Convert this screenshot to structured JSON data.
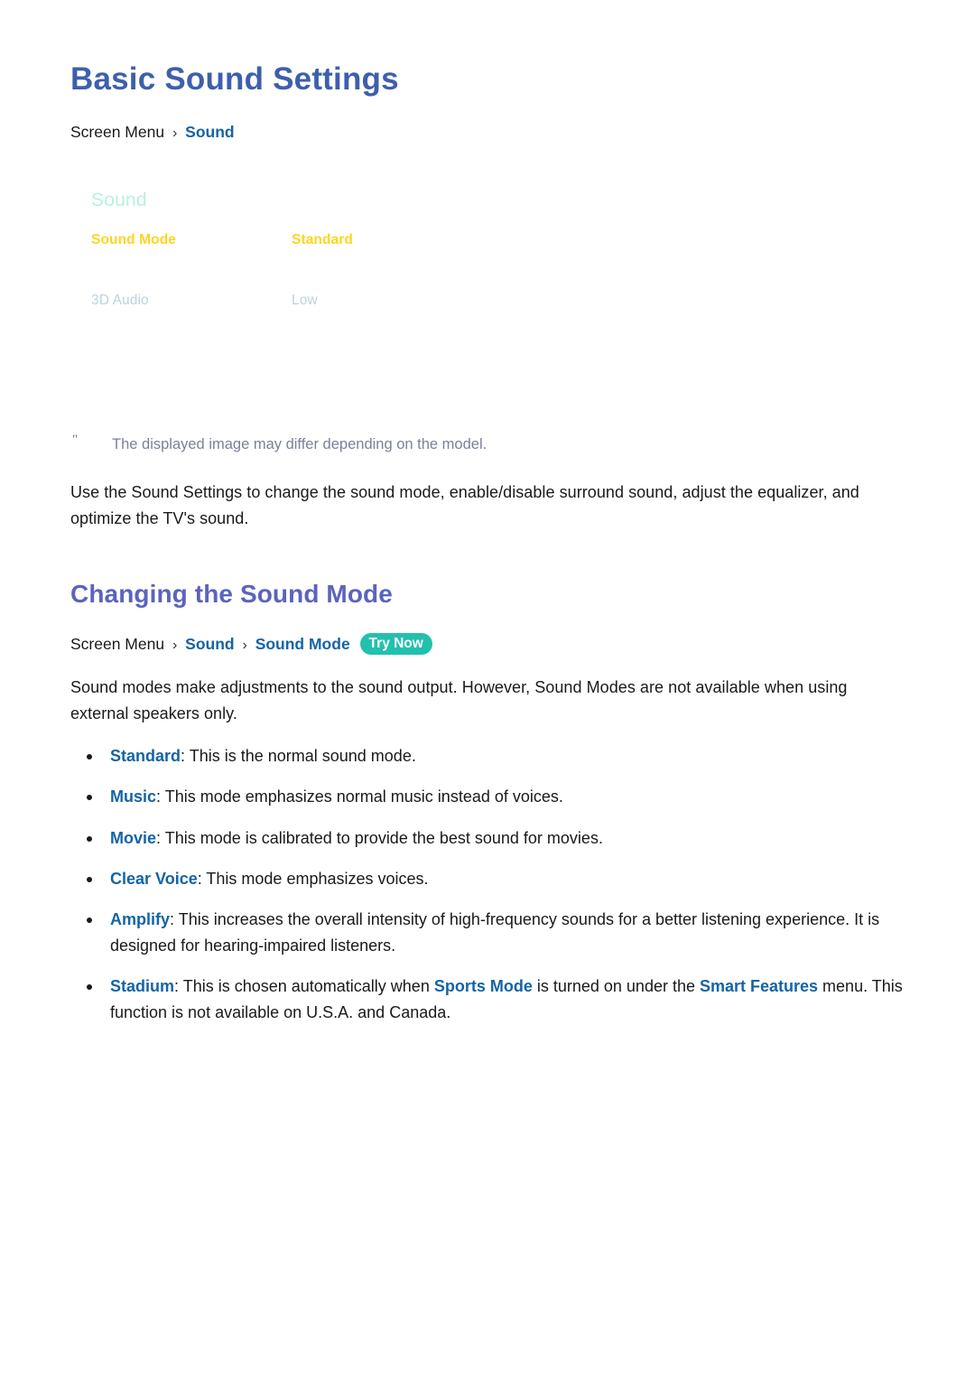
{
  "page": {
    "title": "Basic Sound Settings"
  },
  "breadcrumb_top": {
    "root": "Screen Menu",
    "separator": "›",
    "item1": "Sound"
  },
  "tv_mock": {
    "menu_title": "Sound",
    "rows": [
      {
        "label": "Sound Mode",
        "value": "Standard",
        "state": "active"
      },
      {
        "label": "3D Audio",
        "value": "Low",
        "state": "dim"
      }
    ],
    "colors": {
      "menu_title": "#b4f3dd",
      "active": "#ffd520",
      "dim": "#bcd3dd"
    }
  },
  "footnote": {
    "marker": "\"",
    "text": "The displayed image may differ depending on the model."
  },
  "intro_paragraph": "Use the Sound Settings to change the sound mode, enable/disable surround sound, adjust the equalizer, and optimize the TV's sound.",
  "section": {
    "heading": "Changing the Sound Mode",
    "breadcrumb": {
      "root": "Screen Menu",
      "separator": "›",
      "item1": "Sound",
      "item2": "Sound Mode",
      "badge": "Try Now"
    },
    "paragraph": "Sound modes make adjustments to the sound output. However, Sound Modes are not available when using external speakers only.",
    "bullets": [
      {
        "term": "Standard",
        "sep": ": ",
        "text": "This is the normal sound mode."
      },
      {
        "term": "Music",
        "sep": ": ",
        "text": "This mode emphasizes normal music instead of voices."
      },
      {
        "term": "Movie",
        "sep": ": ",
        "text": "This mode is calibrated to provide the best sound for movies."
      },
      {
        "term": "Clear Voice",
        "sep": ": ",
        "text": "This mode emphasizes voices."
      },
      {
        "term": "Amplify",
        "sep": ": ",
        "text": "This increases the overall intensity of high-frequency sounds for a better listening experience. It is designed for hearing-impaired listeners."
      },
      {
        "term": "Stadium",
        "sep": ": ",
        "text_part1": "This is chosen automatically when ",
        "link1": "Sports Mode",
        "text_part2": " is turned on under the ",
        "link2": "Smart Features",
        "text_part3": " menu. This function is not available on U.S.A. and Canada."
      }
    ]
  },
  "theme": {
    "title_color": "#3e5fad",
    "section_heading_color": "#5b63be",
    "link_color": "#1464a5",
    "badge_color": "#23c0ae",
    "footnote_color": "#7b809a",
    "body_color": "#1a1a1a",
    "background": "#ffffff"
  }
}
